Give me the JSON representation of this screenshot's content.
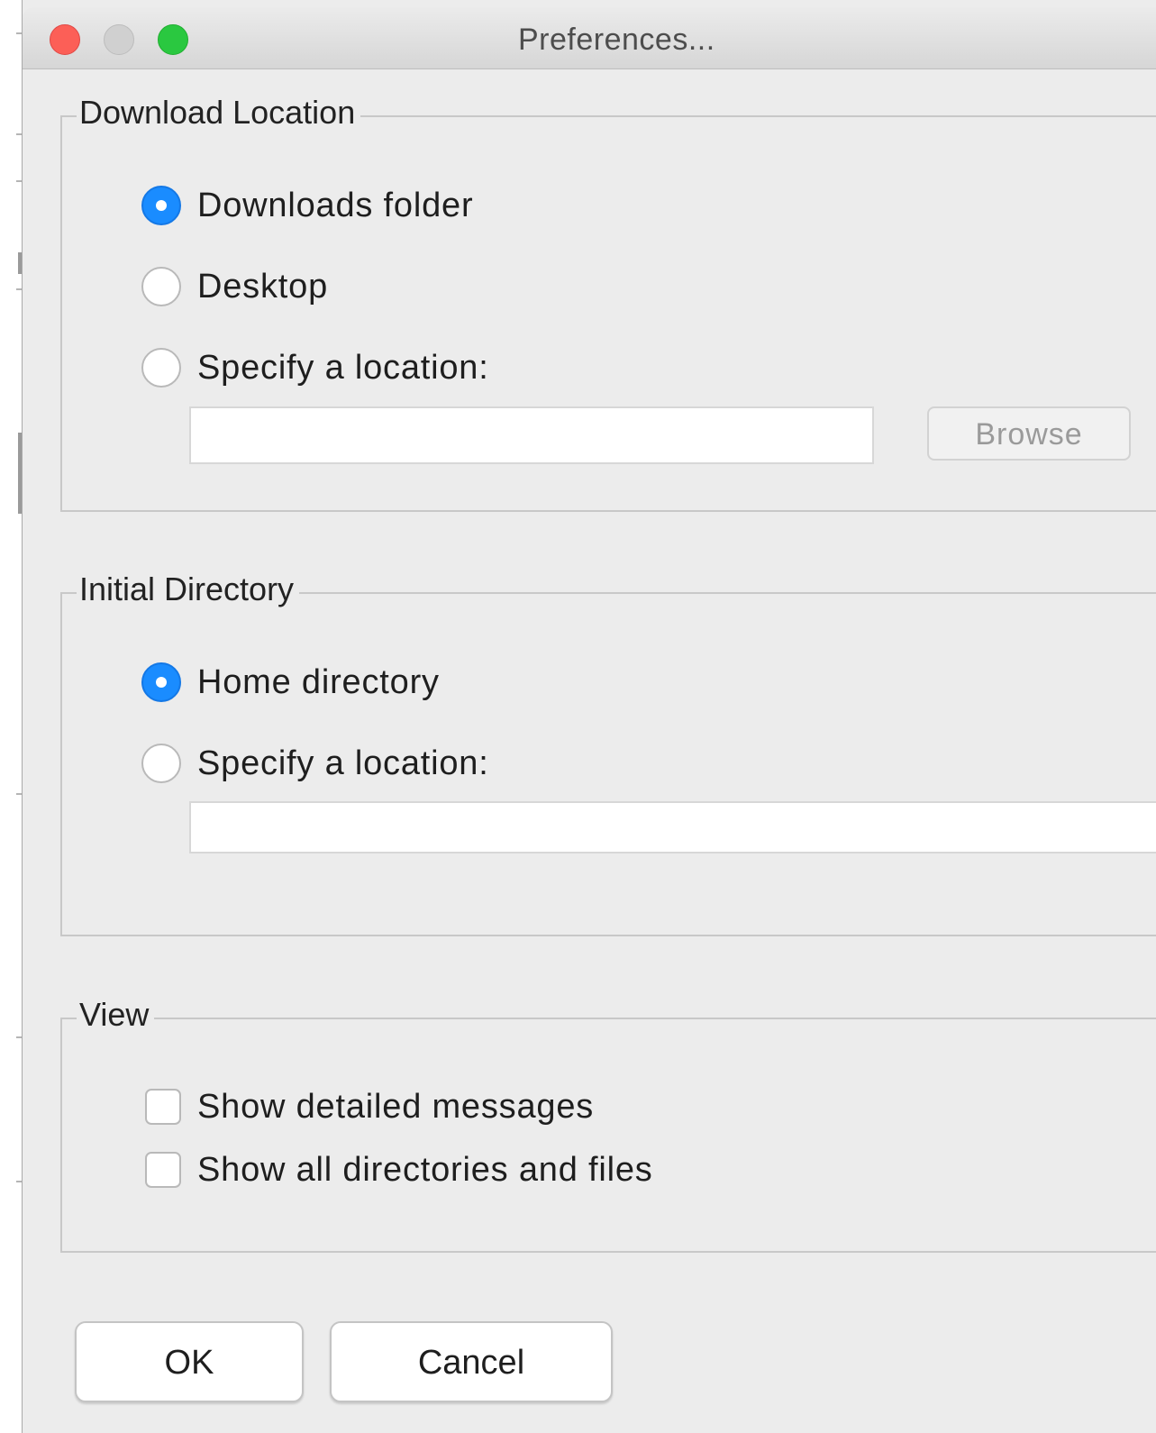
{
  "window": {
    "title": "Preferences..."
  },
  "download_location": {
    "title": "Download Location",
    "options": [
      {
        "label": "Downloads folder",
        "selected": true
      },
      {
        "label": "Desktop",
        "selected": false
      },
      {
        "label": "Specify a location:",
        "selected": false
      }
    ],
    "path_value": "",
    "browse_label": "Browse"
  },
  "initial_directory": {
    "title": "Initial Directory",
    "options": [
      {
        "label": "Home directory",
        "selected": true
      },
      {
        "label": "Specify a location:",
        "selected": false
      }
    ],
    "path_value": ""
  },
  "view": {
    "title": "View",
    "options": [
      {
        "label": "Show detailed messages",
        "checked": false
      },
      {
        "label": "Show all directories and files",
        "checked": false
      }
    ]
  },
  "buttons": {
    "ok": "OK",
    "cancel": "Cancel"
  },
  "colors": {
    "accent": "#1a8cff",
    "close": "#fc5f57",
    "zoom": "#2ac840",
    "background": "#ececec"
  }
}
